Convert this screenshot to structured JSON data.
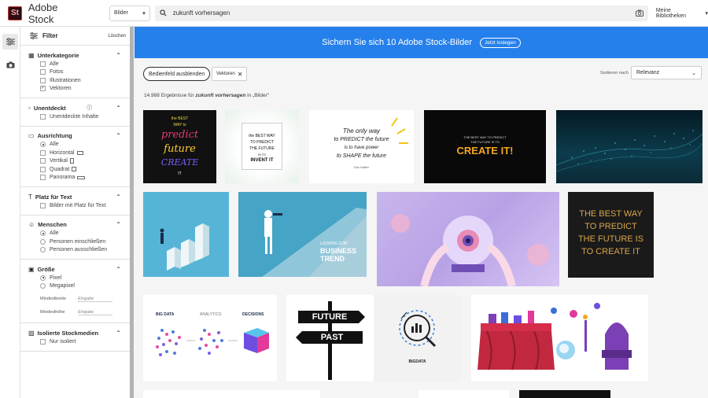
{
  "app": {
    "title": "Adobe Stock",
    "logo_text": "St"
  },
  "search": {
    "scope": "Bilder",
    "query": "zukunft vorhersagen"
  },
  "account": {
    "libraries": "Meine Bibliotheken"
  },
  "filters": {
    "title": "Filter",
    "clear": "Löschen",
    "unterkategorie": {
      "title": "Unterkategorie",
      "options": [
        "Alle",
        "Fotos",
        "Illustrationen",
        "Vektoren"
      ]
    },
    "unentdeckt": {
      "title": "Unentdeckt",
      "options": [
        "Unentdeckte Inhalte"
      ]
    },
    "ausrichtung": {
      "title": "Ausrichtung",
      "options": [
        "Alle",
        "Horizontal",
        "Vertikal",
        "Quadrat",
        "Panorama"
      ]
    },
    "platz": {
      "title": "Platz für Text",
      "options": [
        "Bilder mit Platz für Text"
      ]
    },
    "menschen": {
      "title": "Menschen",
      "options": [
        "Alle",
        "Personen einschließen",
        "Personen ausschließen"
      ]
    },
    "groesse": {
      "title": "Größe",
      "options": [
        "Pixel",
        "Megapixel"
      ],
      "min_width": "Mindestbreite",
      "min_height": "Mindesthöhe",
      "input_placeholder": "Eingabe"
    },
    "isoliert": {
      "title": "Isolierte Stockmedien",
      "options": [
        "Nur isoliert"
      ]
    }
  },
  "banner": {
    "text": "Sichern Sie sich 10 Adobe Stock-Bilder",
    "button": "Jetzt loslegen"
  },
  "toolbar": {
    "hide_panel": "Bedienfeld ausblenden",
    "chip": "Vektoren",
    "sort_label": "Sortieren nach",
    "sort_value": "Relevanz"
  },
  "results": {
    "count": "14.988",
    "pre": " Ergebnisse für ",
    "query": "zukunft vorhersagen",
    "post": " in „Bilder“"
  },
  "images": {
    "i1": [
      "the BEST",
      "WAY to",
      "predict",
      "future",
      "CREATE",
      "IT"
    ],
    "i2": [
      "the BEST WAY",
      "TO PREDICT",
      "THE FUTURE",
      "IS TO",
      "INVENT IT"
    ],
    "i3": [
      "The only way",
      "to PREDICT the future",
      "is to have power",
      "to SHAPE the future",
      "Eric Hoffer"
    ],
    "i4": [
      "THE BEST WAY TO PREDICT",
      "THE FUTURE IS TO",
      "CREATE IT!"
    ],
    "i7": [
      "LOOKING FOR",
      "BUSINESS",
      "TREND"
    ],
    "i9": [
      "THE BEST WAY",
      "TO PREDICT",
      "THE FUTURE IS",
      "TO CREATE IT"
    ],
    "i10": [
      "BIG DATA",
      "ANALYTICS",
      "DECISIONS"
    ],
    "i11": [
      "FUTURE",
      "PAST"
    ],
    "i12": [
      "BIGDATA"
    ]
  }
}
